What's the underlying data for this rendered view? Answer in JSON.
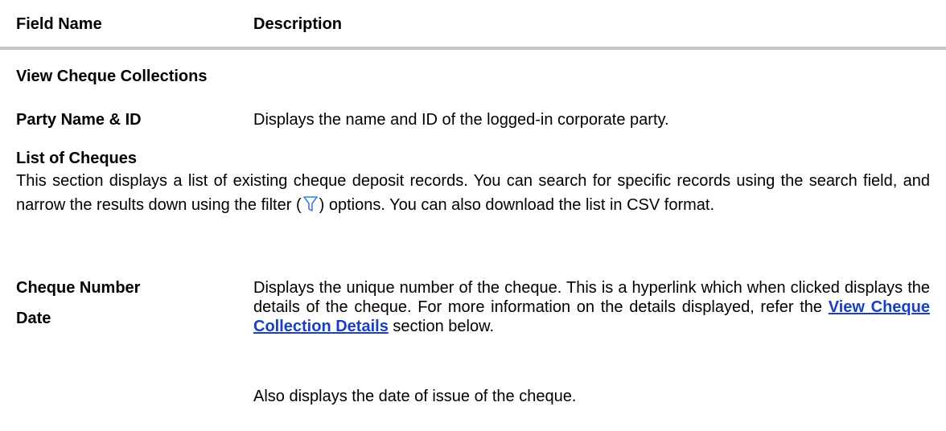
{
  "header": {
    "field_name": "Field Name",
    "description": "Description"
  },
  "section_title": "View Cheque Collections",
  "party": {
    "label": "Party Name & ID",
    "description": "Displays the name and ID of the logged-in corporate party."
  },
  "list": {
    "title": "List of Cheques",
    "para_part1": "This section displays a list of existing cheque deposit records. You can search for specific records using the search field, and narrow the results down using the filter (",
    "para_part2": ") options. You can also download the list in CSV format."
  },
  "cheque": {
    "label1": "Cheque Number",
    "label2": "Date",
    "desc_part1": "Displays the unique number of the cheque. This is a hyperlink which when clicked displays the details of the cheque. For more information on the details displayed, refer the ",
    "link_text": "View Cheque Collection Details",
    "desc_part2": " section below.",
    "desc_line2": "Also displays the date of issue of the cheque."
  },
  "colors": {
    "link": "#1a3fbf",
    "divider": "#c8c8c8",
    "filter_icon": "#3b7fd9"
  },
  "icons": {
    "filter": "funnel-filter-icon"
  }
}
